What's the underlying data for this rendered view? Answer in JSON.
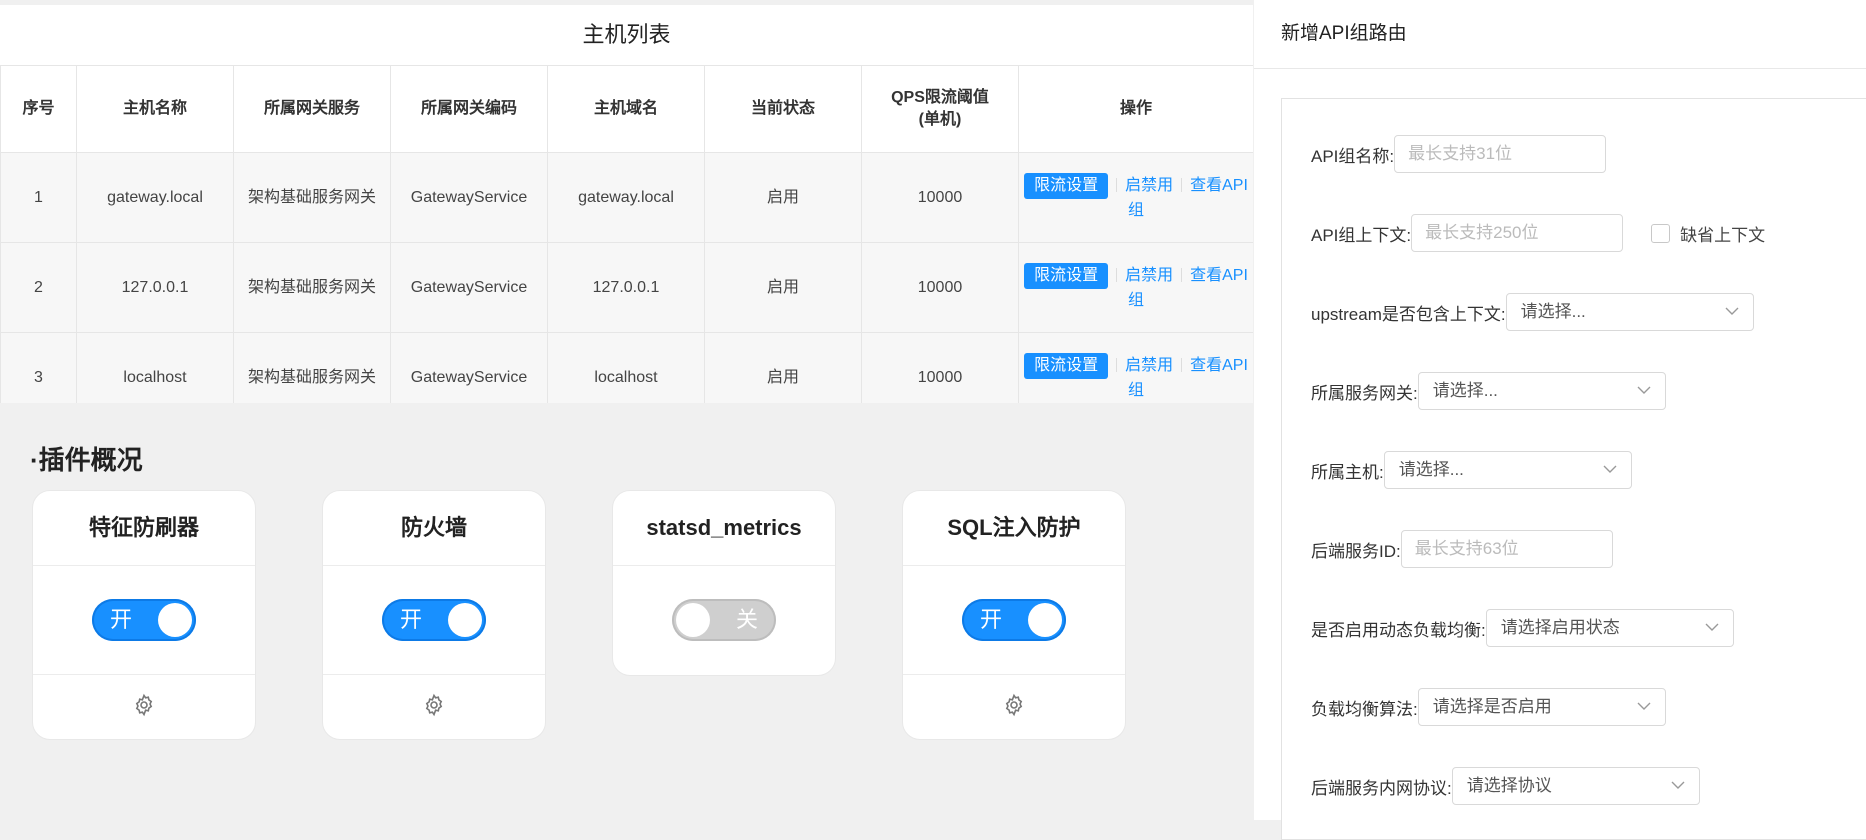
{
  "host_table": {
    "title": "主机列表",
    "columns": [
      "序号",
      "主机名称",
      "所属网关服务",
      "所属网关编码",
      "主机域名",
      "当前状态",
      "QPS限流阈值(单机)",
      "操作"
    ],
    "col_qps_line1": "QPS限流阈值",
    "col_qps_line2": "(单机)",
    "rows": [
      {
        "index": "1",
        "name": "gateway.local",
        "service": "架构基础服务网关",
        "code": "GatewayService",
        "domain": "gateway.local",
        "status": "启用",
        "qps": "10000"
      },
      {
        "index": "2",
        "name": "127.0.0.1",
        "service": "架构基础服务网关",
        "code": "GatewayService",
        "domain": "127.0.0.1",
        "status": "启用",
        "qps": "10000"
      },
      {
        "index": "3",
        "name": "localhost",
        "service": "架构基础服务网关",
        "code": "GatewayService",
        "domain": "localhost",
        "status": "启用",
        "qps": "10000"
      }
    ],
    "op_limit": "限流设置",
    "op_toggle": "启禁用",
    "op_view": "查看API组"
  },
  "plugins": {
    "section_title": "·插件概况",
    "cards": [
      {
        "name": "特征防刷器",
        "state": "on",
        "label": "开",
        "has_settings": true
      },
      {
        "name": "防火墙",
        "state": "on",
        "label": "开",
        "has_settings": true
      },
      {
        "name": "statsd_metrics",
        "state": "off",
        "label": "关",
        "has_settings": false
      },
      {
        "name": "SQL注入防护",
        "state": "on",
        "label": "开",
        "has_settings": true
      }
    ]
  },
  "drawer": {
    "title": "新增API组路由",
    "fields": {
      "api_name": {
        "label": "API组名称:",
        "placeholder": "最长支持31位"
      },
      "api_context": {
        "label": "API组上下文:",
        "placeholder": "最长支持250位",
        "checkbox_label": "缺省上下文"
      },
      "upstream": {
        "label": "upstream是否包含上下文:",
        "value": "请选择..."
      },
      "gateway": {
        "label": "所属服务网关:",
        "value": "请选择..."
      },
      "host": {
        "label": "所属主机:",
        "value": "请选择..."
      },
      "backend_id": {
        "label": "后端服务ID:",
        "placeholder": "最长支持63位"
      },
      "dynamic_lb": {
        "label": "是否启用动态负载均衡:",
        "value": "请选择启用状态"
      },
      "lb_algo": {
        "label": "负载均衡算法:",
        "value": "请选择是否启用"
      },
      "protocol": {
        "label": "后端服务内网协议:",
        "value": "请选择协议"
      }
    }
  }
}
